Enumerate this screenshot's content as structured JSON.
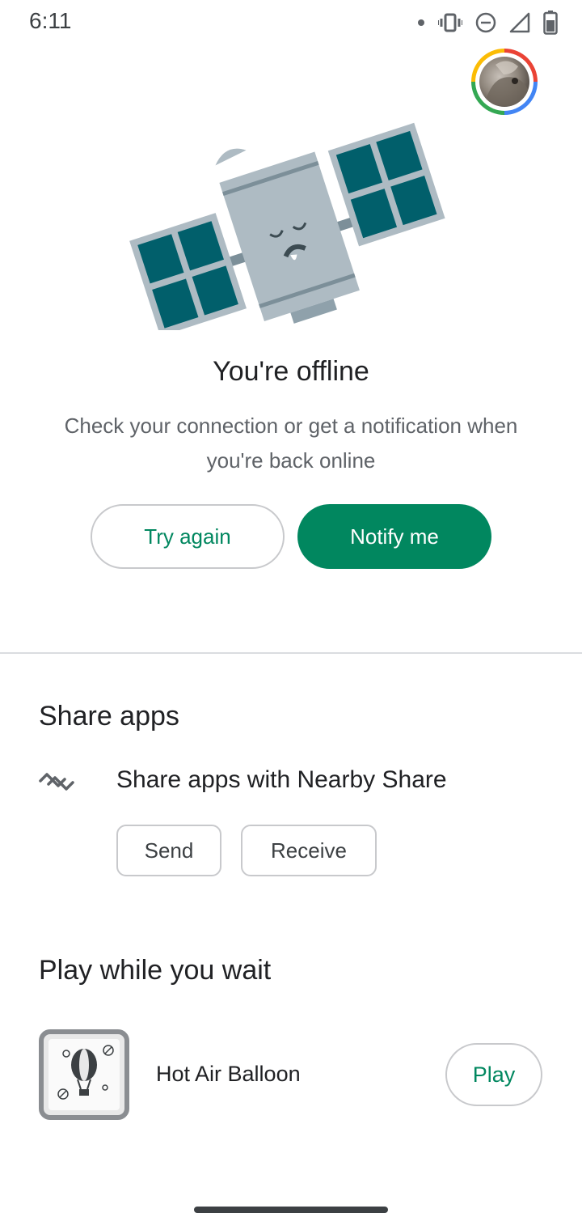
{
  "status_bar": {
    "time": "6:11",
    "icons": [
      "notification-dot-icon",
      "vibrate-icon",
      "do-not-disturb-icon",
      "cell-signal-icon",
      "battery-icon"
    ]
  },
  "account": {
    "avatar": "account-avatar"
  },
  "offline": {
    "title": "You're offline",
    "subtitle": "Check your connection or get a notification when you're back online",
    "try_again_label": "Try again",
    "notify_me_label": "Notify me"
  },
  "share_apps": {
    "title": "Share apps",
    "nearby_label": "Share apps with Nearby Share",
    "send_label": "Send",
    "receive_label": "Receive"
  },
  "play_while_waiting": {
    "title": "Play while you wait",
    "game_name": "Hot Air Balloon",
    "play_label": "Play"
  },
  "colors": {
    "accent": "#01875f",
    "divider": "#dadce0",
    "satellite_panel": "#015f6b",
    "satellite_body": "#aebbc3"
  }
}
